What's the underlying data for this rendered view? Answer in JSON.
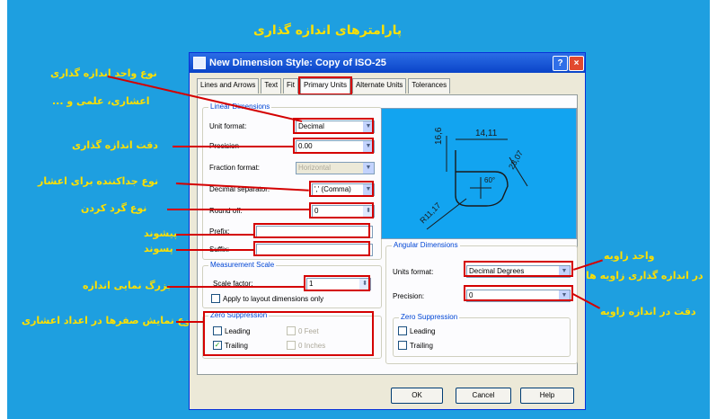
{
  "top_title": "پارامترهای اندازه گذاری",
  "dialog": {
    "title": "New Dimension Style: Copy of ISO-25",
    "help_glyph": "?",
    "close_glyph": "×",
    "tabs": [
      "Lines and Arrows",
      "Text",
      "Fit",
      "Primary Units",
      "Alternate Units",
      "Tolerances"
    ],
    "active_tab": "Primary Units",
    "linear": {
      "title": "Linear Dimensions",
      "unit_format_label": "Unit format:",
      "unit_format_value": "Decimal",
      "precision_label": "Precision",
      "precision_value": "0.00",
      "fraction_format_label": "Fraction format:",
      "fraction_format_value": "Horizontal",
      "decimal_separator_label": "Decimal separator:",
      "decimal_separator_value": "',' (Comma)",
      "round_off_label": "Round off:",
      "round_off_value": "0",
      "prefix_label": "Prefix:",
      "prefix_value": "",
      "suffix_label": "Suffix:",
      "suffix_value": ""
    },
    "measurement": {
      "title": "Measurement Scale",
      "scale_factor_label": "Scale factor:",
      "scale_factor_value": "1",
      "apply_layout_label": "Apply to layout dimensions only"
    },
    "zero_linear": {
      "title": "Zero Suppression",
      "leading": "Leading",
      "trailing": "Trailing",
      "feet": "0 Feet",
      "inches": "0 Inches"
    },
    "angular": {
      "title": "Angular Dimensions",
      "units_format_label": "Units format:",
      "units_format_value": "Decimal Degrees",
      "precision_label": "Precision:",
      "precision_value": "0"
    },
    "zero_angular": {
      "title": "Zero Suppression",
      "leading": "Leading",
      "trailing": "Trailing"
    },
    "preview": {
      "dim_top_left": "16,6",
      "dim_top": "14,11",
      "dim_right": "28,07",
      "dim_angle": "60°",
      "dim_radius": "R11,17"
    },
    "buttons": {
      "ok": "OK",
      "cancel": "Cancel",
      "help": "Help"
    }
  },
  "annotations": {
    "unit_type": "نوع واحد اندازه گذاری",
    "unit_type_sub": "اعشاری، علمی و ...",
    "precision": "دقت اندازه گذاری",
    "separator": "نوع جداکننده برای اعشار",
    "round_off": "نوع گرد کردن",
    "prefix": "پیشوند",
    "suffix": "پسوند",
    "scale": "بزرگ نمایی اندازه",
    "zero": "نوع نمایش صفرها در اعداد اعشاری",
    "angle_unit": "واحد زاویه",
    "angle_unit_sub": "در اندازه گذاری زاویه ها",
    "angle_precision": "دقت در اندازه زاویه"
  },
  "colors": {
    "background": "#1e9fe0",
    "annotation_text": "#ffe000",
    "highlight": "#d40000"
  }
}
